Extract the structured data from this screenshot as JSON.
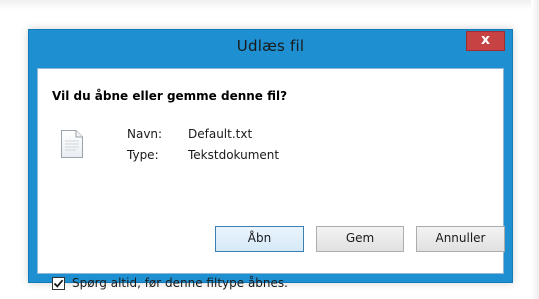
{
  "dialog": {
    "title": "Udlæs fil",
    "close_label": "x",
    "question": "Vil du åbne eller gemme denne fil?",
    "file": {
      "name_label": "Navn:",
      "name_value": "Default.txt",
      "type_label": "Type:",
      "type_value": "Tekstdokument",
      "icon": "text-file-icon"
    },
    "buttons": {
      "open": "Åbn",
      "save": "Gem",
      "cancel": "Annuller"
    },
    "checkbox": {
      "label": "Spørg altid, før denne filtype åbnes.",
      "checked": true
    }
  },
  "colors": {
    "frame": "#1e8fd0",
    "close_button": "#c74343",
    "default_button_border": "#3c7fb1"
  }
}
